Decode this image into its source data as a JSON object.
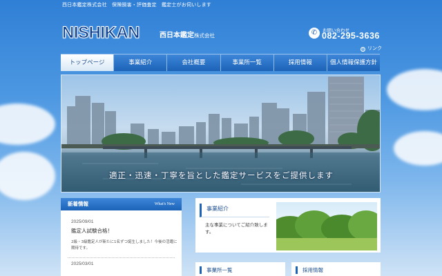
{
  "topbar": {
    "text": "西日本鑑定株式会社　保険損害・評価査定　鑑定士がお伺いします"
  },
  "header": {
    "logo": "NISHIKAN",
    "company_name": "西日本鑑定",
    "company_suffix": "株式会社",
    "contact_label": "お問い合わせ",
    "phone": "082-295-3636",
    "link_label": "リンク"
  },
  "nav": {
    "items": [
      {
        "label": "トップページ"
      },
      {
        "label": "事業紹介"
      },
      {
        "label": "会社概要"
      },
      {
        "label": "事業所一覧"
      },
      {
        "label": "採用情報"
      },
      {
        "label": "個人情報保護方針"
      }
    ]
  },
  "hero": {
    "caption": "適正・迅速・丁寧を旨とした鑑定サービスをご提供します"
  },
  "news": {
    "title": "新着情報",
    "title_en": "What's New",
    "items": [
      {
        "date": "2025/09/01",
        "title": "鑑定人試験合格！",
        "body": "2級・3級鑑定人が新たに1名ずつ誕生しました！今後の活躍に期待です。"
      },
      {
        "date": "2025/03/01"
      }
    ]
  },
  "business": {
    "title": "事業紹介",
    "text": "主な事業についてご紹介致します。"
  },
  "offices": {
    "title": "事業所一覧"
  },
  "recruit": {
    "title": "採用情報"
  },
  "colors": {
    "primary": "#1c63b8",
    "dark": "#0a3d8f",
    "sky": "#4d98e2"
  },
  "icons": {
    "phone": "phone-icon",
    "link": "chevron-right-icon"
  }
}
